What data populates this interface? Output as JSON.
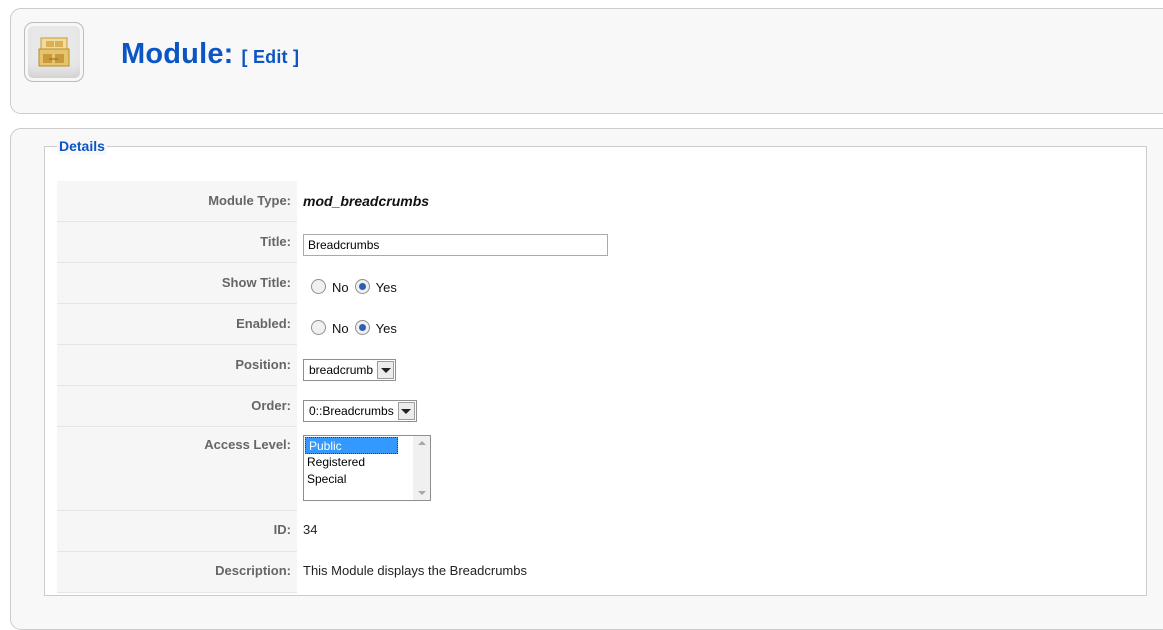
{
  "header": {
    "title": "Module:",
    "subtitle": "[ Edit ]",
    "icon": "module-icon"
  },
  "details": {
    "legend": "Details",
    "module_type": {
      "label": "Module Type:",
      "value": "mod_breadcrumbs"
    },
    "title": {
      "label": "Title:",
      "value": "Breadcrumbs"
    },
    "show_title": {
      "label": "Show Title:",
      "no": "No",
      "yes": "Yes",
      "selected": "Yes"
    },
    "enabled": {
      "label": "Enabled:",
      "no": "No",
      "yes": "Yes",
      "selected": "Yes"
    },
    "position": {
      "label": "Position:",
      "selected": "breadcrumb"
    },
    "order": {
      "label": "Order:",
      "selected": "0::Breadcrumbs"
    },
    "access_level": {
      "label": "Access Level:",
      "options": [
        "Public",
        "Registered",
        "Special"
      ],
      "selected": "Public"
    },
    "id": {
      "label": "ID:",
      "value": "34"
    },
    "description": {
      "label": "Description:",
      "value": "This Module displays the Breadcrumbs"
    }
  },
  "colors": {
    "accent": "#0b55c4",
    "selection": "#3399ff"
  }
}
